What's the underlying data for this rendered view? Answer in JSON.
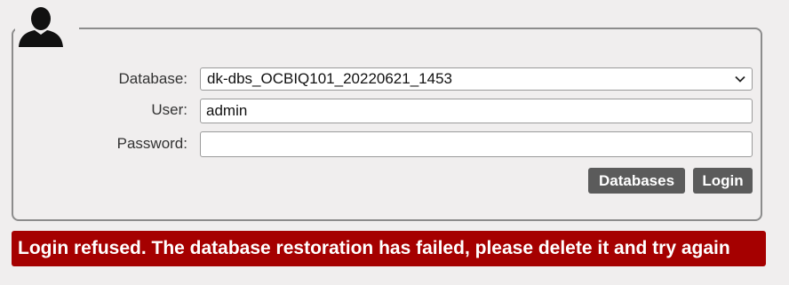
{
  "form": {
    "database_label": "Database:",
    "database_value": "dk-dbs_OCBIQ101_20220621_1453",
    "user_label": "User:",
    "user_value": "admin",
    "password_label": "Password:",
    "password_value": ""
  },
  "buttons": {
    "databases": "Databases",
    "login": "Login"
  },
  "error": {
    "message": "Login refused. The database restoration has failed, please delete it and try again"
  },
  "icons": {
    "avatar": "user-silhouette-icon",
    "select_arrow": "chevron-down-icon"
  },
  "colors": {
    "background": "#f0eeee",
    "button": "#5b5b5b",
    "error": "#a50000",
    "border": "#8c8c8c"
  }
}
